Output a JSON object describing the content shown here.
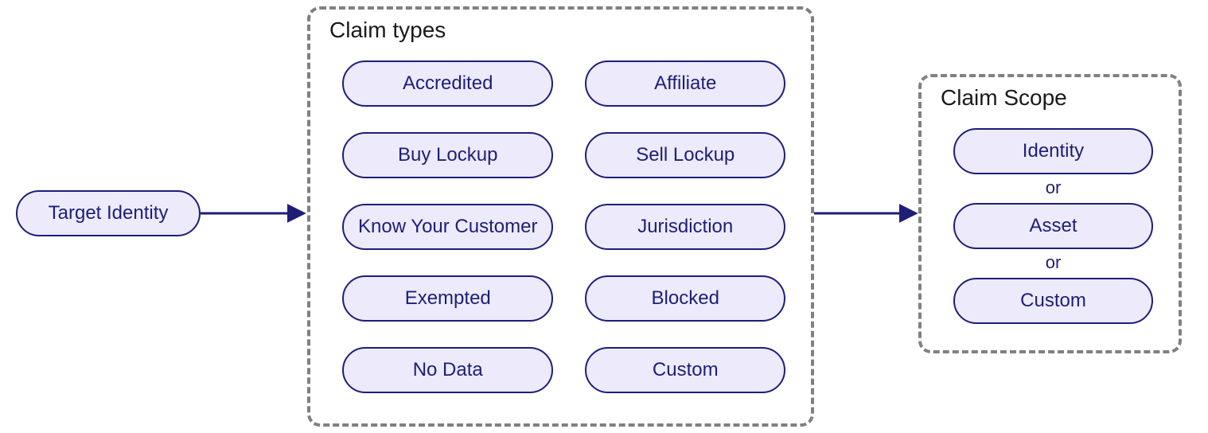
{
  "target": {
    "label": "Target Identity"
  },
  "claim_types": {
    "title": "Claim types",
    "col1": [
      "Accredited",
      "Buy Lockup",
      "Know Your Customer",
      "Exempted",
      "No Data"
    ],
    "col2": [
      "Affiliate",
      "Sell Lockup",
      "Jurisdiction",
      "Blocked",
      "Custom"
    ]
  },
  "claim_scope": {
    "title": "Claim Scope",
    "items": [
      "Identity",
      "Asset",
      "Custom"
    ],
    "separator": "or"
  },
  "colors": {
    "primary": "#1e1e78",
    "fill": "#eceafb",
    "dash": "#808080"
  }
}
